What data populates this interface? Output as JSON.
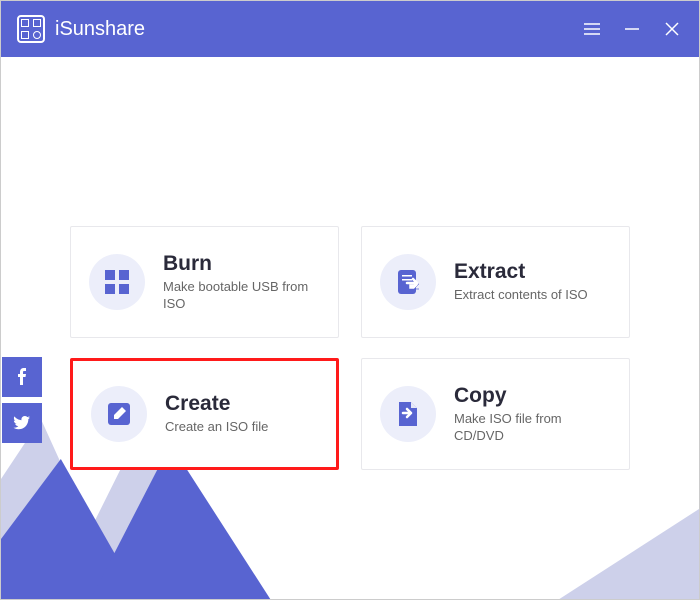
{
  "app": {
    "title": "iSunshare"
  },
  "cards": {
    "burn": {
      "title": "Burn",
      "desc": "Make bootable USB from ISO"
    },
    "extract": {
      "title": "Extract",
      "desc": "Extract contents of ISO"
    },
    "create": {
      "title": "Create",
      "desc": "Create an ISO file"
    },
    "copy": {
      "title": "Copy",
      "desc": "Make ISO file from CD/DVD"
    }
  },
  "colors": {
    "primary": "#5864d1",
    "highlight": "#ff1a1a",
    "iconBg": "#eceefa"
  }
}
